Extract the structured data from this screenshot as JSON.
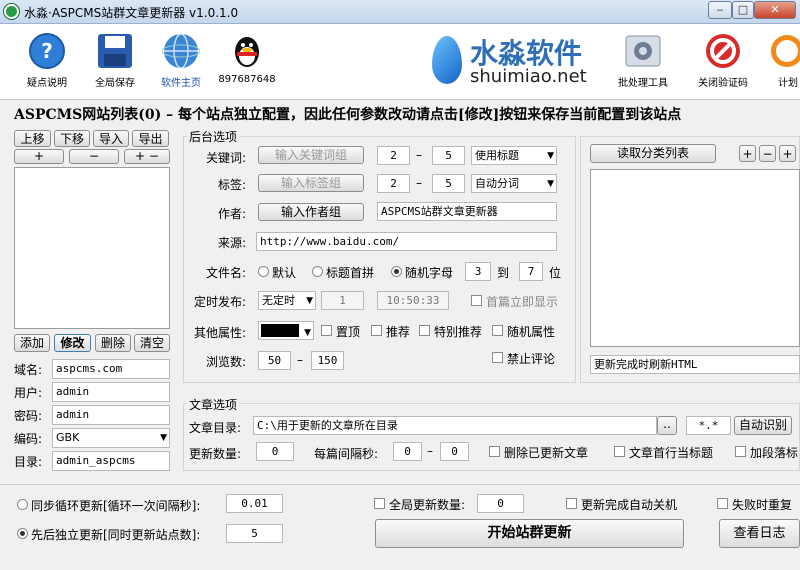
{
  "window": {
    "title": "水淼·ASPCMS站群文章更新器 v1.0.1.0",
    "min": "‒",
    "max": "□",
    "close": "✕"
  },
  "toolbar": {
    "items": [
      {
        "label": "疑点说明",
        "icon": "help-icon"
      },
      {
        "label": "全局保存",
        "icon": "floppy-save-icon"
      },
      {
        "label": "软件主页",
        "icon": "globe-icon"
      },
      {
        "label": "897687648",
        "icon": "qq-penguin-icon"
      },
      {
        "label": "批处理工具",
        "icon": "batch-tool-icon"
      },
      {
        "label": "关闭验证码",
        "icon": "stop-icon"
      },
      {
        "label": "计划",
        "icon": "plan-icon"
      }
    ],
    "logo_cn": "水淼软件",
    "logo_en": "shuimiao.net"
  },
  "headline": "ASPCMS网站列表(0) – 每个站点独立配置，因此任何参数改动请点击[修改]按钮来保存当前配置到该站点",
  "left": {
    "move_up": "上移",
    "move_down": "下移",
    "import": "导入",
    "export": "导出",
    "plus": "+",
    "minus": "−",
    "plusminus": "+ −",
    "add": "添加",
    "edit": "修改",
    "delete": "删除",
    "clear": "清空",
    "domain_label": "域名:",
    "domain": "aspcms.com",
    "user_label": "用户:",
    "user": "admin",
    "pass_label": "密码:",
    "pass": "admin",
    "enc_label": "编码:",
    "enc": "GBK",
    "dir_label": "目录:",
    "dir": "admin_aspcms"
  },
  "backend": {
    "title": "后台选项",
    "kw_label": "关键词:",
    "kw_btn": "输入关键词组",
    "kw_min": "2",
    "kw_max": "5",
    "kw_mode": "使用标题",
    "tag_label": "标签:",
    "tag_btn": "输入标签组",
    "tag_min": "2",
    "tag_max": "5",
    "tag_mode": "自动分词",
    "author_label": "作者:",
    "author_btn": "输入作者组",
    "author_value": "ASPCMS站群文章更新器",
    "source_label": "来源:",
    "source_value": "http://www.baidu.com/",
    "fname_label": "文件名:",
    "fname_default": "默认",
    "fname_pinyin": "标题首拼",
    "fname_random": "随机字母",
    "fname_from": "3",
    "fname_to_label": "到",
    "fname_to": "7",
    "fname_unit": "位",
    "sched_label": "定时发布:",
    "sched_mode": "无定时",
    "sched_num": "1",
    "sched_time": "10:50:33",
    "sched_first": "首篇立即显示",
    "other_label": "其他属性:",
    "top": "置顶",
    "recommend": "推荐",
    "special": "特别推荐",
    "random_attr": "随机属性",
    "views_label": "浏览数:",
    "views_min": "50",
    "views_max": "150",
    "no_comment": "禁止评论",
    "dash": "–"
  },
  "category": {
    "read_btn": "读取分类列表",
    "plus": "+",
    "minus": "−",
    "more": "+",
    "after_update": "更新完成时刷新HTML"
  },
  "article": {
    "title": "文章选项",
    "dir_label": "文章目录:",
    "dir_value": "C:\\用于更新的文章所在目录",
    "browse": "..",
    "ext": "*.*",
    "auto": "自动识别",
    "count_label": "更新数量:",
    "count": "0",
    "interval_label": "每篇间隔秒:",
    "int_min": "0",
    "int_max": "0",
    "delete_updated": "删除已更新文章",
    "first_line_title": "文章首行当标题",
    "add_para": "加段落标"
  },
  "bottom": {
    "sync_label": "同步循环更新[循环一次间隔秒]:",
    "sync_value": "0.01",
    "seq_label": "先后独立更新[同时更新站点数]:",
    "seq_value": "5",
    "global_count_label": "全局更新数量:",
    "global_count": "0",
    "shutdown": "更新完成自动关机",
    "retry": "失败时重复",
    "start": "开始站群更新",
    "view_log": "查看日志"
  }
}
